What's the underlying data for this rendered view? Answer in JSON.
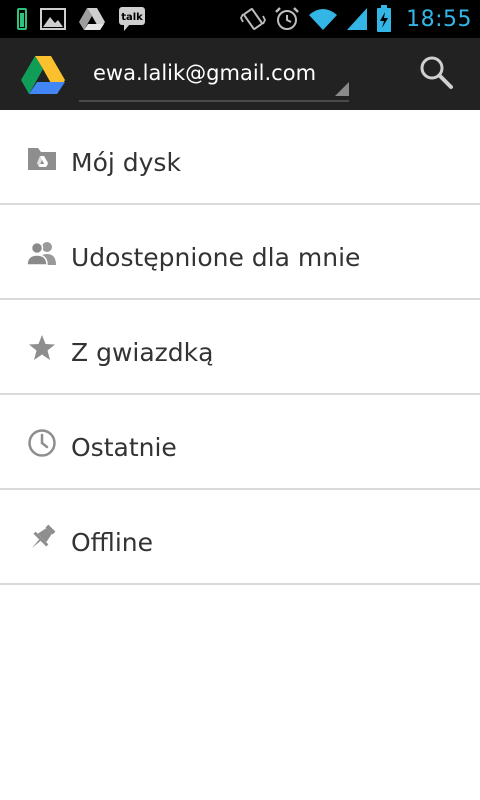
{
  "status_bar": {
    "time": "18:55",
    "notification_icons": [
      "battery-saver-icon",
      "gallery-icon",
      "drive-icon",
      "talk-icon"
    ],
    "talk_badge": "talk",
    "system_icons": [
      "vibrate-icon",
      "alarm-icon",
      "wifi-icon",
      "signal-icon",
      "battery-charging-icon"
    ],
    "accent_color": "#33b5e5"
  },
  "action_bar": {
    "account": "ewa.lalik@gmail.com",
    "app_icon": "google-drive-logo",
    "search_icon": "search-icon"
  },
  "nav": {
    "items": [
      {
        "label": "Mój dysk",
        "icon": "drive-folder-icon"
      },
      {
        "label": "Udostępnione dla mnie",
        "icon": "people-icon"
      },
      {
        "label": "Z gwiazdką",
        "icon": "star-icon"
      },
      {
        "label": "Ostatnie",
        "icon": "clock-icon"
      },
      {
        "label": "Offline",
        "icon": "pin-icon"
      }
    ]
  }
}
